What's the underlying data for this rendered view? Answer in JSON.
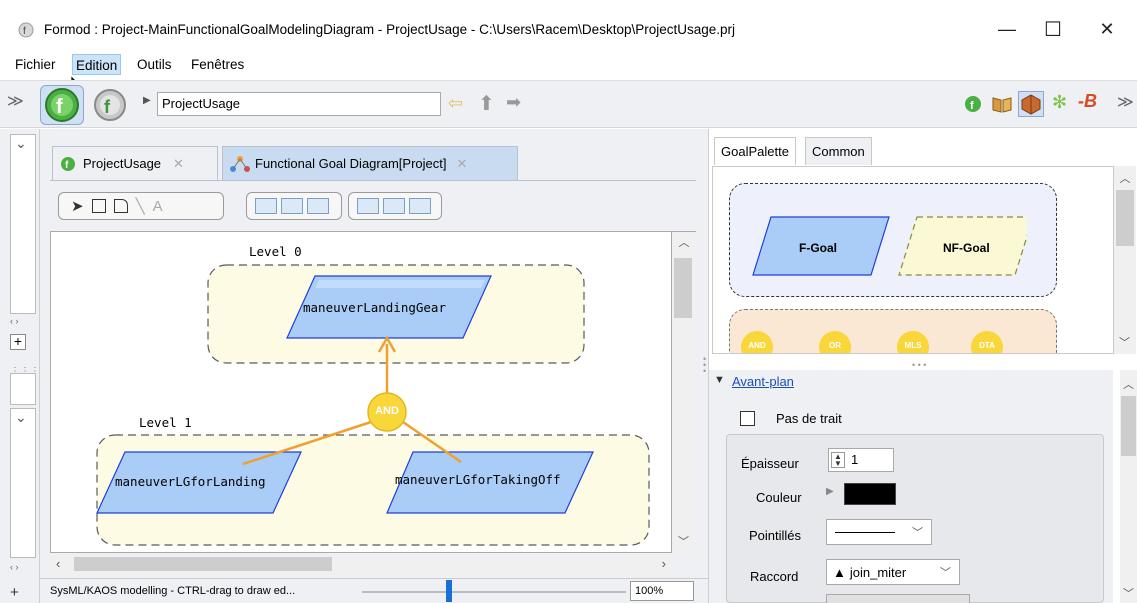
{
  "window": {
    "title": "Formod : Project-MainFunctionalGoalModelingDiagram - ProjectUsage - C:\\Users\\Racem\\Desktop\\ProjectUsage.prj",
    "minimize": "—",
    "maximize": "☐",
    "close": "✕"
  },
  "menu": [
    "Fichier",
    "Edition",
    "Outils",
    "Fenêtres"
  ],
  "toolbar": {
    "address": "ProjectUsage"
  },
  "tabs": {
    "project_usage": "ProjectUsage",
    "functional_goal": "Functional Goal Diagram[Project]"
  },
  "diagram": {
    "level0": "Level 0",
    "level1": "Level 1",
    "root_goal": "maneuverLandingGear",
    "and_label": "AND",
    "goal_left": "maneuverLGforLanding",
    "goal_right": "maneuverLGforTakingOff"
  },
  "status": {
    "text": "SysML/KAOS modelling - CTRL-drag to draw ed...",
    "zoom": "100%"
  },
  "palette": {
    "tabs": [
      "GoalPalette",
      "Common"
    ],
    "f_goal": "F-Goal",
    "nf_goal": "NF-Goal",
    "ops": [
      "AND",
      "OR",
      "MLS",
      "DTA"
    ]
  },
  "props": {
    "section": "Avant-plan",
    "no_stroke": "Pas de trait",
    "thickness_label": "Épaisseur",
    "thickness_value": "1",
    "color_label": "Couleur",
    "dashes_label": "Pointillés",
    "join_label": "Raccord",
    "join_value": "join_miter"
  },
  "colors": {
    "goal_fill": "#a9cdf7",
    "goal_stroke": "#1f3fd6",
    "nfgoal_fill": "#fbf8d6",
    "level_fill": "#fdfbe4",
    "and_fill": "#f9d63a",
    "arrow": "#f0a030"
  }
}
